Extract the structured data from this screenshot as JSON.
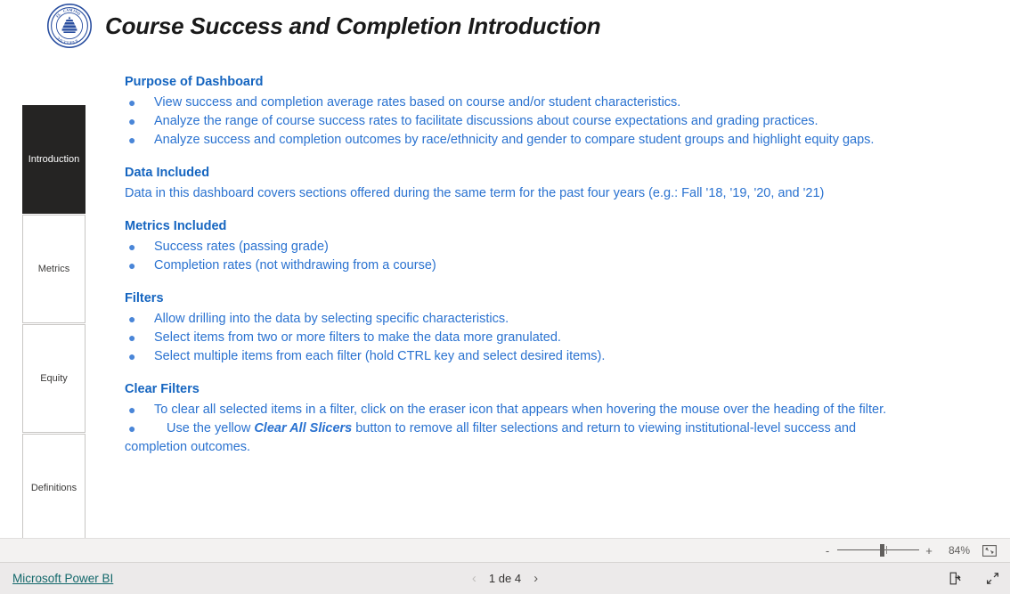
{
  "header": {
    "title": "Course Success and Completion Introduction",
    "logo_alt": "El Camino College seal",
    "logo_text_top": "EL CAMINO",
    "logo_text_bottom": "COLLEGE"
  },
  "page_tabs": [
    {
      "label": "Introduction",
      "active": true
    },
    {
      "label": "Metrics",
      "active": false
    },
    {
      "label": "Equity",
      "active": false
    },
    {
      "label": "Definitions",
      "active": false
    }
  ],
  "sections": {
    "purpose": {
      "heading": "Purpose of Dashboard",
      "bullets": [
        "View success and completion average rates based on course and/or student characteristics.",
        "Analyze the range of course success rates to facilitate discussions about course expectations and grading practices.",
        "Analyze success and completion outcomes by race/ethnicity and gender to compare student groups and highlight equity gaps."
      ]
    },
    "data_included": {
      "heading": "Data Included",
      "paragraph": "Data in this dashboard covers sections offered during the same term for the past four years (e.g.: Fall '18, '19, '20, and '21)"
    },
    "metrics_included": {
      "heading": "Metrics Included",
      "bullets": [
        "Success rates (passing grade)",
        "Completion rates (not withdrawing from a course)"
      ]
    },
    "filters": {
      "heading": "Filters",
      "bullets": [
        "Allow drilling into the data by selecting specific characteristics.",
        "Select items from two or more filters to make the data more granulated.",
        "Select multiple items from each filter (hold CTRL key and select desired items)."
      ]
    },
    "clear_filters": {
      "heading": "Clear Filters",
      "bullet_1": "To clear all selected items in a filter, click on the eraser icon that appears when hovering the mouse over the heading of the filter.",
      "bullet_2_pre": "Use the yellow ",
      "bullet_2_emphasis": "Clear All Slicers",
      "bullet_2_post": " button to remove all filter selections and return to viewing institutional-level success and",
      "bullet_2_wrap": "completion outcomes."
    }
  },
  "zoom_bar": {
    "minus_label": "-",
    "plus_label": "+",
    "value": "84%",
    "fit_icon": "fit-to-page-icon"
  },
  "footer": {
    "powerbi_link": "Microsoft Power BI",
    "prev_arrow": "‹",
    "next_arrow": "›",
    "page_label": "1 de 4",
    "share_icon": "share-icon",
    "fullscreen_icon": "fullscreen-icon"
  },
  "colors": {
    "heading_blue": "#1565C0",
    "body_blue": "#2a72d0",
    "active_tab_bg": "#252423",
    "link_teal": "#13686b",
    "footer_bg": "#eceaea"
  }
}
